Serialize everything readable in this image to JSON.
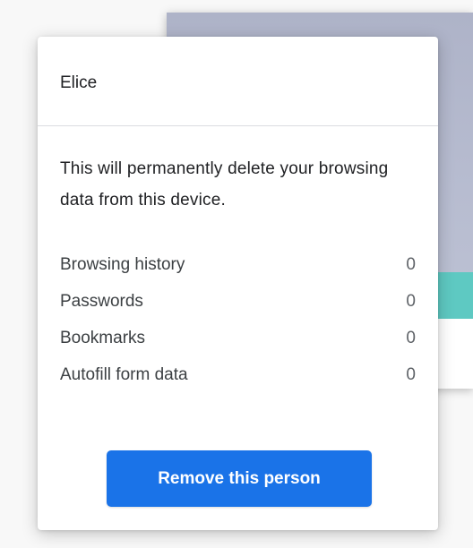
{
  "dialog": {
    "profile_name": "Elice",
    "warning_text": "This will permanently delete your browsing data from this device.",
    "stats": [
      {
        "label": "Browsing history",
        "count": "0"
      },
      {
        "label": "Passwords",
        "count": "0"
      },
      {
        "label": "Bookmarks",
        "count": "0"
      },
      {
        "label": "Autofill form data",
        "count": "0"
      }
    ],
    "remove_button_label": "Remove this person"
  },
  "colors": {
    "primary_button": "#1a73e8",
    "accent_teal": "#5ec9c2",
    "banner": "#b7bcd0"
  }
}
